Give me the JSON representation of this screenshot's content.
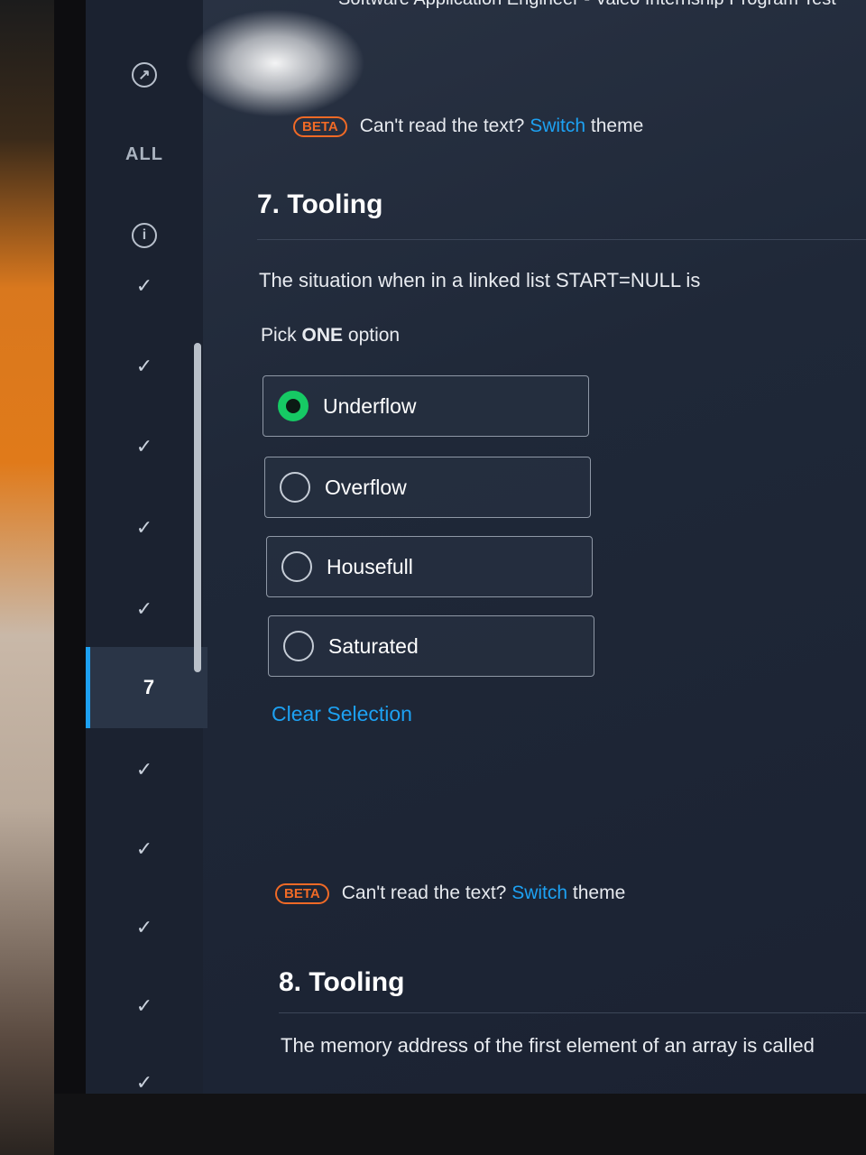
{
  "window": {
    "title": "Software Application Engineer - Valeo Internship Program Test"
  },
  "sidebar": {
    "all_label": "ALL",
    "active_question": "7",
    "items": [
      {
        "status": "done",
        "mark": "✓"
      },
      {
        "status": "done",
        "mark": "✓"
      },
      {
        "status": "done",
        "mark": "✓"
      },
      {
        "status": "done",
        "mark": "✓"
      },
      {
        "status": "done",
        "mark": "✓"
      },
      {
        "status": "current",
        "mark": "7"
      },
      {
        "status": "done",
        "mark": "✓"
      },
      {
        "status": "done",
        "mark": "✓"
      },
      {
        "status": "done",
        "mark": "✓"
      },
      {
        "status": "done",
        "mark": "✓"
      },
      {
        "status": "done",
        "mark": "✓"
      }
    ]
  },
  "theme_notice": {
    "prefix": "Can't read the text?",
    "link": "Switch",
    "suffix": "theme",
    "badge": "BETA"
  },
  "question7": {
    "heading": "7. Tooling",
    "text": "The situation when in a linked list START=NULL is",
    "pick_prefix": "Pick",
    "pick_strong": "ONE",
    "pick_suffix": "option",
    "options": [
      {
        "label": "Underflow",
        "selected": true
      },
      {
        "label": "Overflow",
        "selected": false
      },
      {
        "label": "Housefull",
        "selected": false
      },
      {
        "label": "Saturated",
        "selected": false
      }
    ],
    "clear_label": "Clear Selection"
  },
  "question8": {
    "heading": "8. Tooling",
    "text": "The memory address of the first element of an array is called"
  },
  "colors": {
    "accent": "#1da1f2",
    "selected": "#16c964",
    "beta": "#f06a26",
    "background": "#1f2838"
  }
}
